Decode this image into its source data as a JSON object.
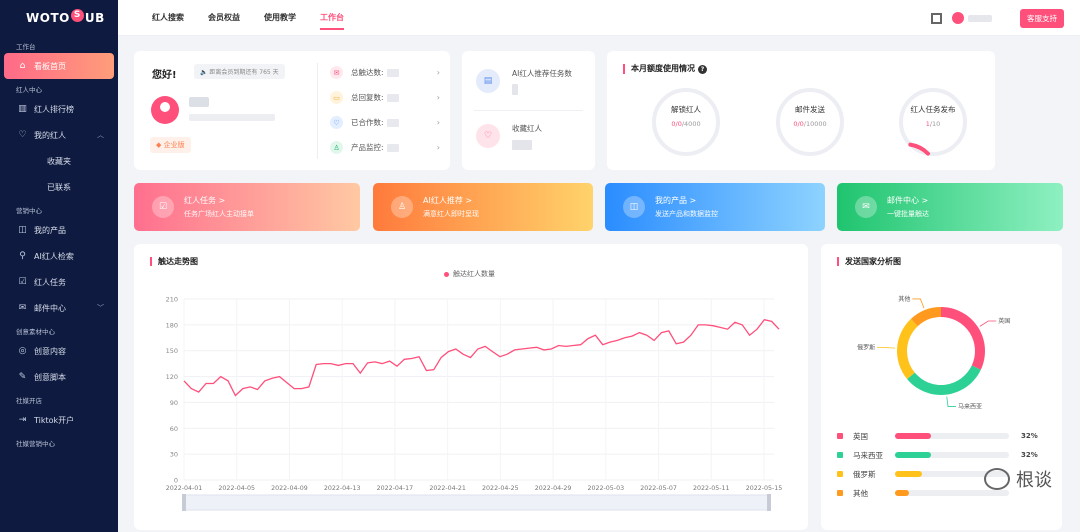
{
  "logo": {
    "brand_left": "WOTO",
    "brand_mid": "S",
    "brand_right": "UB"
  },
  "sidebar": {
    "sections": [
      {
        "title": "工作台"
      },
      {
        "title": "红人中心"
      },
      {
        "title": "营销中心"
      },
      {
        "title": "创意素材中心"
      },
      {
        "title": "社媒开店"
      },
      {
        "title": "社媒营销中心"
      }
    ],
    "items": {
      "dashboard": "看板首页",
      "ranking": "红人排行榜",
      "my_influencers": "我的红人",
      "favorites": "收藏夹",
      "contacted": "已联系",
      "my_products": "我的产品",
      "ai_search": "AI红人检索",
      "tasks": "红人任务",
      "mail_center": "邮件中心",
      "creative_content": "创意内容",
      "creative_script": "创意脚本",
      "tiktok_shop": "Tiktok开户"
    }
  },
  "topbar": {
    "nav": [
      "红人搜索",
      "会员权益",
      "使用教学",
      "工作台"
    ],
    "active_index": 3,
    "support": "客服支持"
  },
  "greeting": {
    "title": "您好!",
    "expire": "距离会员到期还有 765 天",
    "badge": "企业版",
    "stats": [
      {
        "label": "总触达数:",
        "icon": "mail-icon",
        "color": "#ff4f7b",
        "bg": "#ffe8ee"
      },
      {
        "label": "总回复数:",
        "icon": "chat-icon",
        "color": "#f5a623",
        "bg": "#fff3dc"
      },
      {
        "label": "已合作数:",
        "icon": "handshake-icon",
        "color": "#3b82f6",
        "bg": "#e3eeff"
      },
      {
        "label": "产品监控:",
        "icon": "monitor-icon",
        "color": "#22b573",
        "bg": "#e2f7ec"
      }
    ]
  },
  "ai": {
    "recommend": "AI红人推荐任务数",
    "favorites": "收藏红人"
  },
  "quota": {
    "title": "本月额度使用情况",
    "items": [
      {
        "label": "解锁红人",
        "used": "0",
        "mid": "/0",
        "total": "/4000",
        "fraction": 0.0
      },
      {
        "label": "邮件发送",
        "used": "0",
        "mid": "/0",
        "total": "/10000",
        "fraction": 0.0
      },
      {
        "label": "红人任务发布",
        "used": "1",
        "mid": "",
        "total": "/10",
        "fraction": 0.1
      }
    ]
  },
  "banners": [
    {
      "title": "红人任务 >",
      "sub": "任务广场红人主动接单",
      "icon": "task-icon"
    },
    {
      "title": "AI红人推荐 >",
      "sub": "满意红人即时呈现",
      "icon": "user-icon"
    },
    {
      "title": "我的产品 >",
      "sub": "发送产品和数据监控",
      "icon": "bag-icon"
    },
    {
      "title": "邮件中心 >",
      "sub": "一键批量触达",
      "icon": "mail-icon"
    }
  ],
  "trend": {
    "title": "触达走势图",
    "legend": "触达红人数量"
  },
  "chart_data": {
    "type": "line",
    "title": "触达走势图",
    "legend": [
      "触达红人数量"
    ],
    "ylim": [
      0,
      210
    ],
    "yticks": [
      0,
      30,
      60,
      90,
      120,
      150,
      180,
      210
    ],
    "xticks": [
      "2022-04-01",
      "2022-04-05",
      "2022-04-09",
      "2022-04-13",
      "2022-04-17",
      "2022-04-21",
      "2022-04-25",
      "2022-04-29",
      "2022-05-03",
      "2022-05-07",
      "2022-05-11",
      "2022-05-15"
    ],
    "series": [
      {
        "name": "触达红人数量",
        "values": [
          115,
          106,
          102,
          112,
          112,
          120,
          115,
          98,
          106,
          108,
          105,
          115,
          118,
          120,
          113,
          106,
          106,
          108,
          134,
          135,
          135,
          133,
          135,
          135,
          124,
          136,
          137,
          135,
          138,
          132,
          140,
          141,
          143,
          127,
          128,
          142,
          149,
          152,
          146,
          142,
          152,
          155,
          149,
          143,
          146,
          151,
          152,
          153,
          154,
          151,
          152,
          156,
          155,
          156,
          157,
          164,
          168,
          157,
          160,
          162,
          165,
          167,
          171,
          168,
          162,
          171,
          173,
          158,
          160,
          168,
          180,
          180,
          179,
          177,
          175,
          183,
          180,
          168,
          175,
          186,
          184,
          175
        ]
      }
    ],
    "grid": true
  },
  "country": {
    "title": "发送国家分析图",
    "rows": [
      {
        "name": "英国",
        "pct": "32%",
        "value": 32,
        "color": "#ff4f7b"
      },
      {
        "name": "马来西亚",
        "pct": "32%",
        "value": 32,
        "color": "#2dd195"
      },
      {
        "name": "俄罗斯",
        "pct": "",
        "value": 24,
        "color": "#ffc21a"
      },
      {
        "name": "其他",
        "pct": "",
        "value": 12,
        "color": "#ff9a1f"
      }
    ]
  },
  "watermark": "根谈"
}
